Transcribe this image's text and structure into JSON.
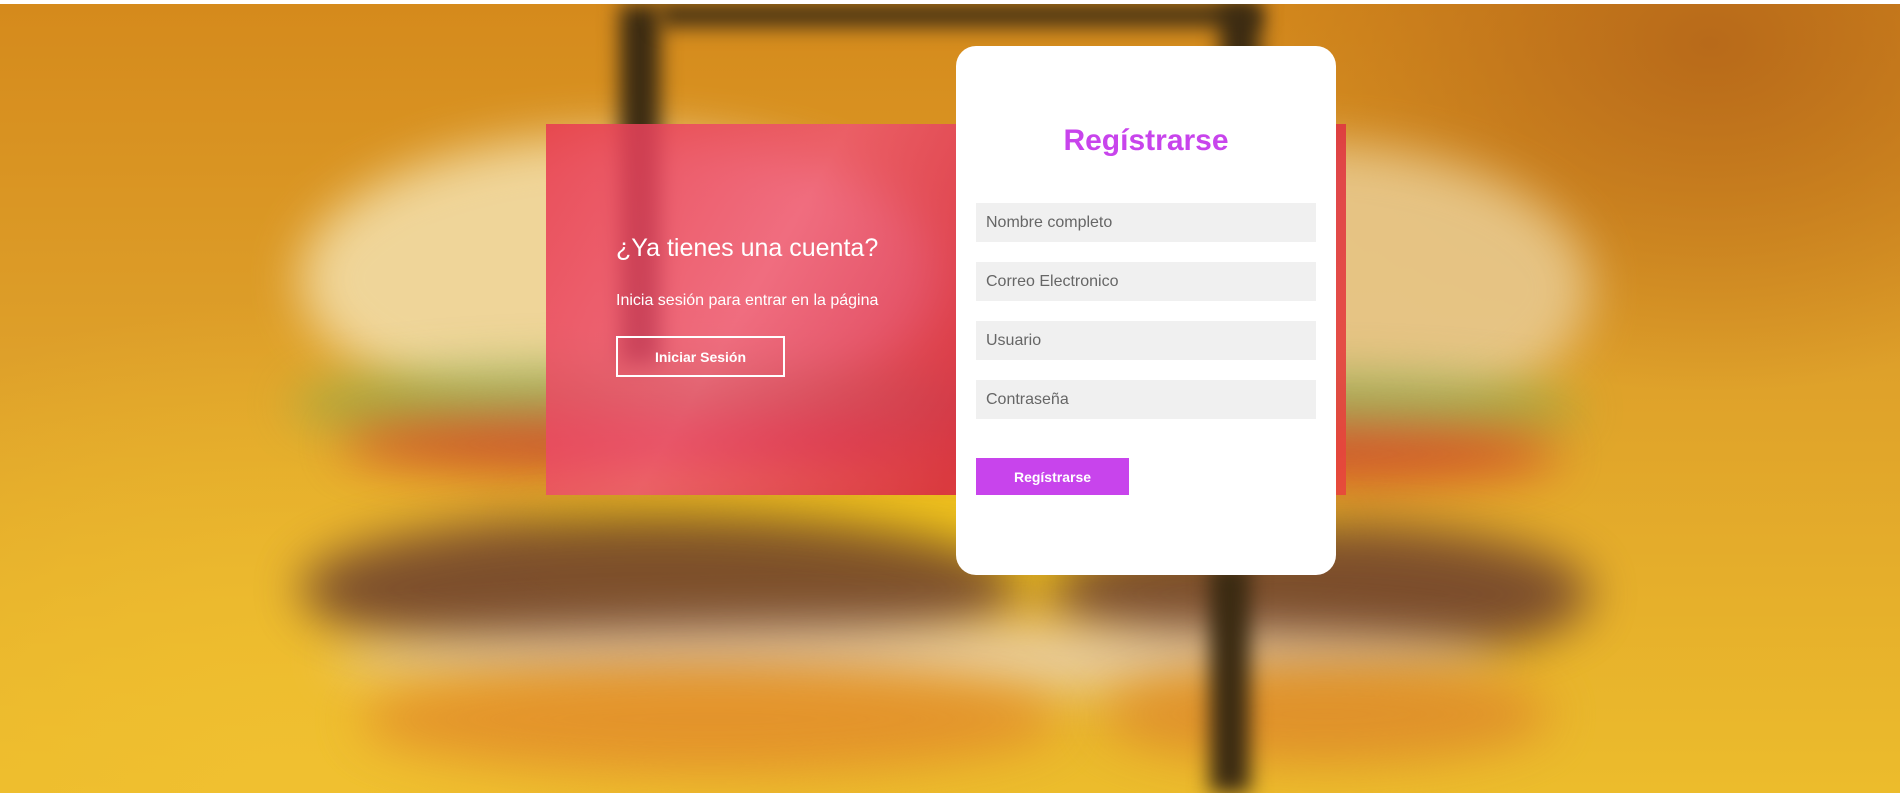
{
  "login_panel": {
    "title": "¿Ya tienes una cuenta?",
    "text": "Inicia sesión para entrar en la página",
    "button_label": "Iniciar Sesión"
  },
  "register": {
    "title": "Regístrarse",
    "fields": [
      {
        "placeholder": "Nombre completo",
        "value": ""
      },
      {
        "placeholder": "Correo Electronico",
        "value": ""
      },
      {
        "placeholder": "Usuario",
        "value": ""
      },
      {
        "placeholder": "Contraseña",
        "value": ""
      }
    ],
    "button_label": "Regístrarse"
  },
  "colors": {
    "accent": "#c844ec",
    "overlay": "#e23c5a",
    "background": "#dea02a"
  }
}
